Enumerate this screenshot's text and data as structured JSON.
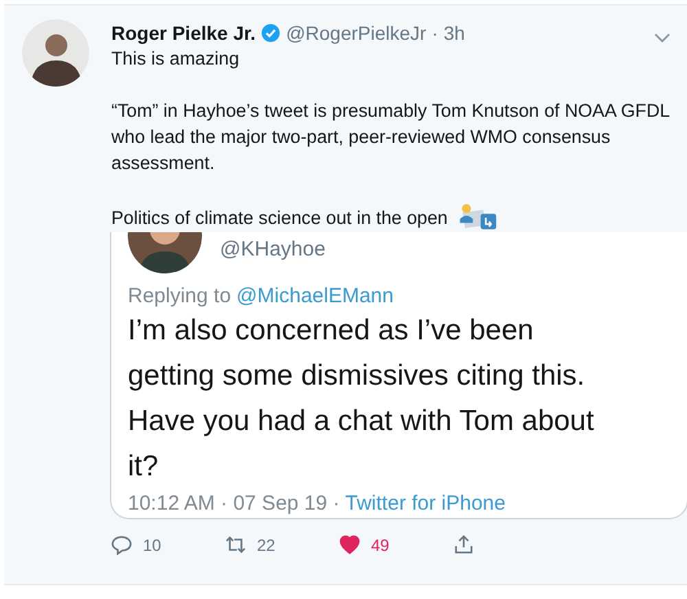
{
  "tweet": {
    "name": "Roger Pielke Jr.",
    "verified": true,
    "handle": "@RogerPielkeJr",
    "separator": "·",
    "time": "3h",
    "paragraphs": [
      "This is amazing",
      "“Tom” in Hayhoe’s tweet is presumably Tom Knutson of NOAA GFDL who lead the major two-part, peer-reviewed WMO consensus assessment.",
      "Politics of climate science out in the open"
    ]
  },
  "quoted": {
    "handle": "@KHayhoe",
    "replying_label": "Replying to",
    "replying_to": "@MichaelEMann",
    "text": "I’m also concerned as I’ve been getting some dismissives citing this. Have you had a chat with Tom about it?",
    "timestamp": "10:12 AM · 07 Sep 19 ·",
    "client": "Twitter for iPhone"
  },
  "actions": [
    {
      "kind": "reply",
      "count": "10",
      "selected": false
    },
    {
      "kind": "retweet",
      "count": "22",
      "selected": false
    },
    {
      "kind": "like",
      "count": "49",
      "selected": true
    },
    {
      "kind": "share",
      "selected": false
    }
  ]
}
